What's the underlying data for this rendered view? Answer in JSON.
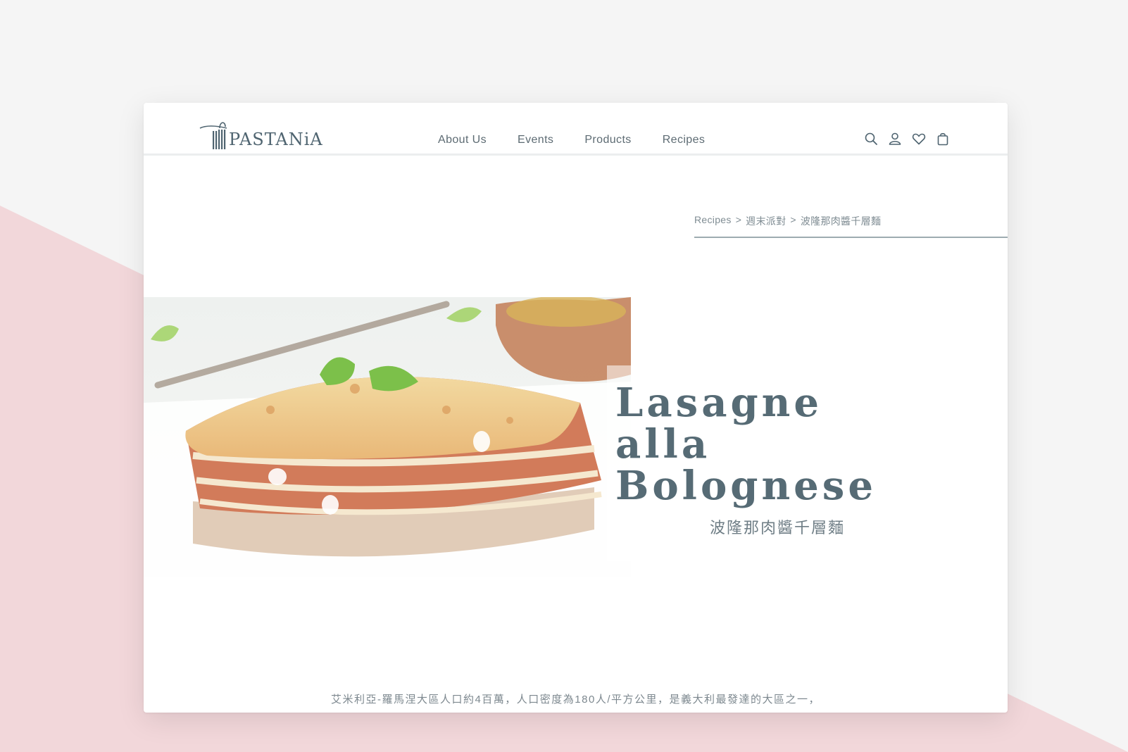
{
  "brand": {
    "name": "Pastania",
    "logo_text": "PASTANiA"
  },
  "nav": {
    "items": [
      "About Us",
      "Events",
      "Products",
      "Recipes"
    ]
  },
  "header_icons": [
    "search-icon",
    "user-icon",
    "heart-icon",
    "shopping-bag-icon"
  ],
  "breadcrumb": {
    "items": [
      "Recipes",
      "週末派對",
      "波隆那肉醬千層麵"
    ],
    "separator": ">"
  },
  "recipe": {
    "title_lines": [
      "Lasagne",
      "alla",
      "Bolognese"
    ],
    "subtitle": "波隆那肉醬千層麵",
    "image_alt": "lasagne-photo",
    "intro": "艾米利亞-羅馬涅大區人口約4百萬，人口密度為180人/平方公里，是義大利最發達的大區之一，"
  },
  "colors": {
    "accent": "#566b75",
    "background": "#f5f5f5",
    "pink_band": "#f2d7da",
    "card": "#ffffff"
  }
}
